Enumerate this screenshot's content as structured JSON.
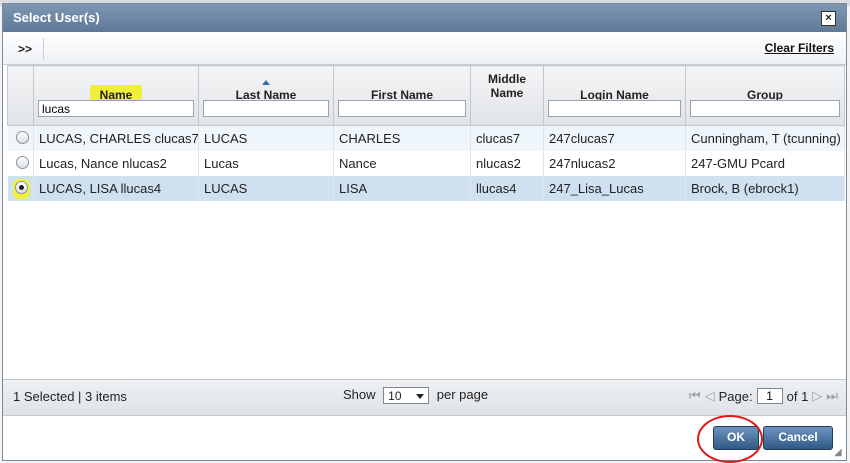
{
  "dialog": {
    "title": "Select User(s)",
    "close_symbol": "×",
    "expand_label": ">>",
    "clear_filters_label": "Clear Filters"
  },
  "columns": [
    {
      "key": "name",
      "label": "Name",
      "filter": "lucas"
    },
    {
      "key": "last_name",
      "label": "Last Name",
      "filter": ""
    },
    {
      "key": "first_name",
      "label": "First Name",
      "filter": ""
    },
    {
      "key": "middle_name",
      "label": "Middle Name",
      "filter": ""
    },
    {
      "key": "login_name",
      "label": "Login Name",
      "filter": ""
    },
    {
      "key": "group",
      "label": "Group",
      "filter": ""
    }
  ],
  "rows": [
    {
      "name": "LUCAS, CHARLES clucas7",
      "last_name": "LUCAS",
      "first_name": "CHARLES",
      "middle_name": "clucas7",
      "login_name": "247clucas7",
      "group": "Cunningham, T (tcunning)",
      "selected": false
    },
    {
      "name": "Lucas, Nance nlucas2",
      "last_name": "Lucas",
      "first_name": "Nance",
      "middle_name": "nlucas2",
      "login_name": "247nlucas2",
      "group": "247-GMU Pcard",
      "selected": false
    },
    {
      "name": "LUCAS, LISA llucas4",
      "last_name": "LUCAS",
      "first_name": "LISA",
      "middle_name": "llucas4",
      "login_name": "247_Lisa_Lucas",
      "group": "Brock, B (ebrock1)",
      "selected": true
    }
  ],
  "footer": {
    "selection_summary": "1 Selected | 3 items",
    "show_label": "Show",
    "page_size": "10",
    "per_page_label": "per page",
    "page_label": "Page:",
    "page_value": "1",
    "of_label": "of 1"
  },
  "buttons": {
    "ok_label": "OK",
    "cancel_label": "Cancel"
  },
  "icons": {
    "first_page": "⏮",
    "prev_page": "◁",
    "next_page": "▷",
    "last_page": "⏭",
    "resize": "◢"
  }
}
